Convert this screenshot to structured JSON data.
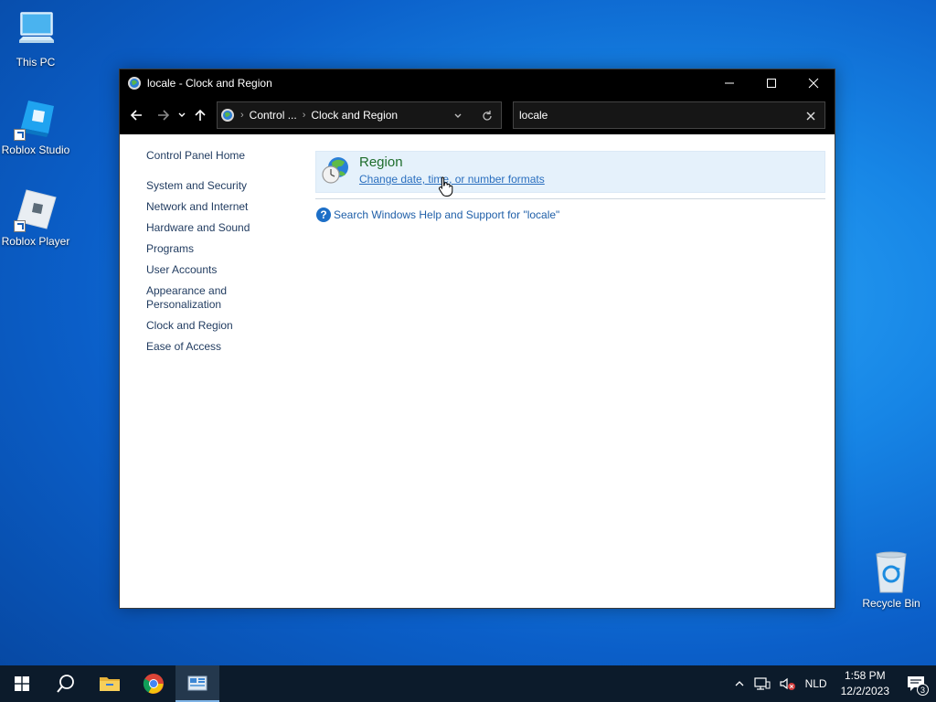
{
  "desktop": {
    "icons": [
      {
        "label": "This PC",
        "icon": "computer-icon"
      },
      {
        "label": "Roblox Studio",
        "icon": "roblox-studio-icon"
      },
      {
        "label": "Roblox Player",
        "icon": "roblox-player-icon"
      },
      {
        "label": "Recycle Bin",
        "icon": "recycle-bin-icon"
      }
    ]
  },
  "window": {
    "title": "locale - Clock and Region",
    "breadcrumb": [
      "Control ...",
      "Clock and Region"
    ],
    "search_value": "locale",
    "left_nav": {
      "home": "Control Panel Home",
      "items": [
        "System and Security",
        "Network and Internet",
        "Hardware and Sound",
        "Programs",
        "User Accounts",
        "Appearance and Personalization",
        "Clock and Region",
        "Ease of Access"
      ]
    },
    "result": {
      "heading": "Region",
      "link": "Change date, time, or number formats",
      "icon": "globe-clock-icon"
    },
    "help_link": "Search Windows Help and Support for \"locale\""
  },
  "taskbar": {
    "pinned": [
      "start-icon",
      "search-icon",
      "file-explorer-icon",
      "chrome-icon",
      "control-panel-icon"
    ],
    "language": "NLD",
    "time": "1:58 PM",
    "date": "12/2/2023",
    "notifications": "3"
  },
  "colors": {
    "desktop_blue": "#1786e6",
    "titlebar": "#000000",
    "result_highlight": "#e5f1fb",
    "heading_green": "#1e6d2b",
    "link_blue": "#2a6fbf",
    "taskbar": "#0c1b2b"
  }
}
